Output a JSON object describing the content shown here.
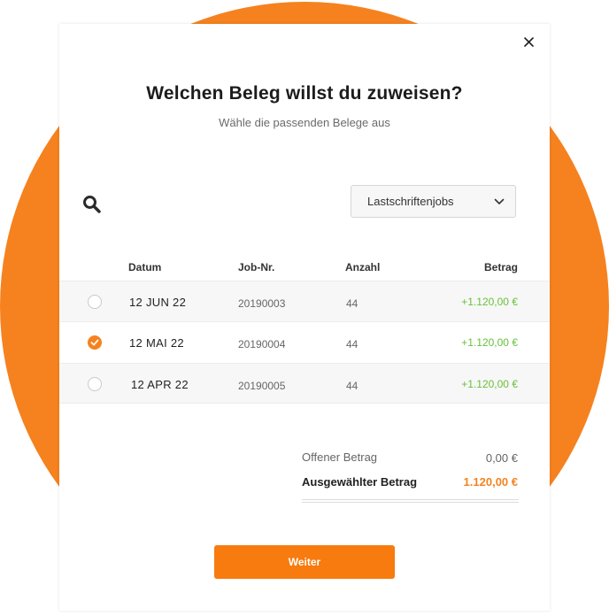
{
  "dialog": {
    "title": "Welchen Beleg willst du zuweisen?",
    "subtitle": "Wähle die passenden Belege aus",
    "close_icon": "close-icon"
  },
  "toolbar": {
    "search_icon": "search-icon",
    "filter": {
      "selected": "Lastschriftenjobs",
      "icon": "chevron-down-icon"
    }
  },
  "table": {
    "columns": {
      "date": "Datum",
      "job": "Job-Nr.",
      "count": "Anzahl",
      "amount": "Betrag"
    },
    "rows": [
      {
        "date": "12 JUN 22",
        "job": "20190003",
        "count": "44",
        "amount": "+1.120,00 €",
        "selected": false
      },
      {
        "date": "12 MAI 22",
        "job": "20190004",
        "count": "44",
        "amount": "+1.120,00 €",
        "selected": true
      },
      {
        "date": "12 APR 22",
        "job": "20190005",
        "count": "44",
        "amount": "+1.120,00 €",
        "selected": false
      }
    ]
  },
  "summary": {
    "open_label": "Offener Betrag",
    "open_value": "0,00 €",
    "selected_label": "Ausgewählter Betrag",
    "selected_value": "1.120,00 €"
  },
  "actions": {
    "next_label": "Weiter"
  },
  "colors": {
    "accent": "#f5821f",
    "positive": "#67c23a"
  }
}
